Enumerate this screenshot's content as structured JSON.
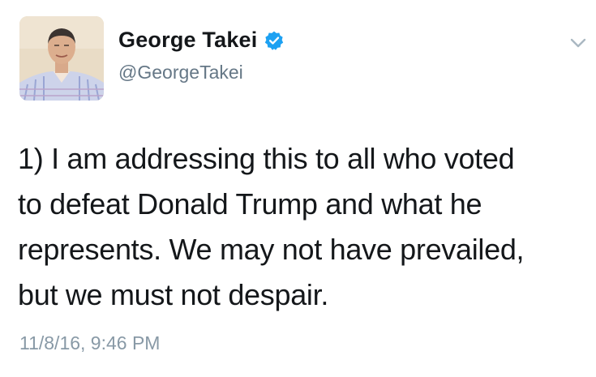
{
  "author": {
    "display_name": "George Takei",
    "handle": "@GeorgeTakei",
    "verified": true,
    "avatar_icon": "profile-photo"
  },
  "tweet": {
    "lines": [
      "1) I am addressing this to all who voted",
      "to defeat Donald Trump and what he",
      "represents. We may not have prevailed,",
      "but we must not despair."
    ],
    "timestamp": "11/8/16, 9:46 PM"
  },
  "icons": {
    "verified": "verified-badge-icon",
    "menu": "chevron-down-icon"
  },
  "colors": {
    "text": "#14171a",
    "secondary": "#657786",
    "timestamp": "#8899a6",
    "verified": "#1da1f2"
  }
}
